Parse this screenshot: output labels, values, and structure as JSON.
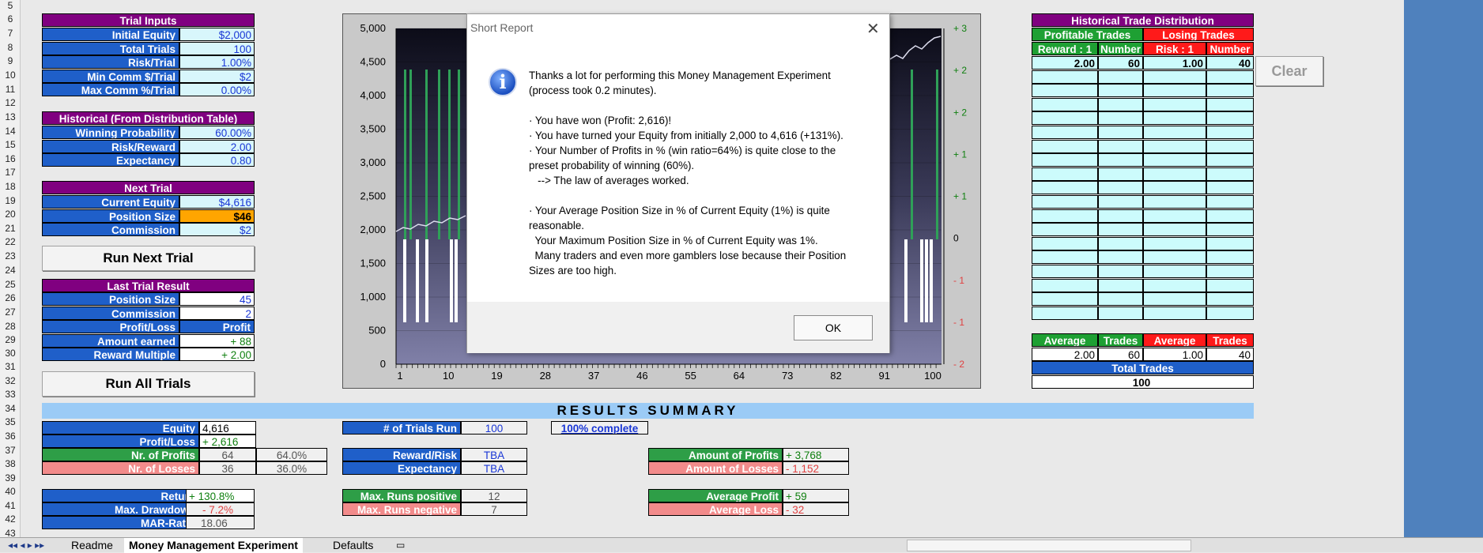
{
  "rows": [
    "5",
    "6",
    "7",
    "8",
    "9",
    "10",
    "11",
    "12",
    "13",
    "14",
    "15",
    "16",
    "17",
    "18",
    "19",
    "20",
    "21",
    "22",
    "23",
    "24",
    "25",
    "26",
    "27",
    "28",
    "29",
    "30",
    "31",
    "32",
    "33",
    "34",
    "35",
    "36",
    "37",
    "38",
    "39",
    "40",
    "41",
    "42",
    "43"
  ],
  "trial_inputs": {
    "header": "Trial  Inputs",
    "items": [
      {
        "label": "Initial Equity",
        "value": "$2,000"
      },
      {
        "label": "Total Trials",
        "value": "100"
      },
      {
        "label": "Risk/Trial",
        "value": "1.00%"
      },
      {
        "label": "Min Comm $/Trial",
        "value": "$2"
      },
      {
        "label": "Max Comm %/Trial",
        "value": "0.00%"
      }
    ]
  },
  "historical": {
    "header": "Historical (From Distribution Table)",
    "items": [
      {
        "label": "Winning Probability",
        "value": "60.00%"
      },
      {
        "label": "Risk/Reward",
        "value": "2.00"
      },
      {
        "label": "Expectancy",
        "value": "0.80"
      }
    ]
  },
  "next_trial": {
    "header": "Next Trial",
    "items": [
      {
        "label": "Current Equity",
        "value": "$4,616"
      },
      {
        "label": "Position Size",
        "value": "$46"
      },
      {
        "label": "Commission",
        "value": "$2"
      }
    ]
  },
  "buttons": {
    "run_next": "Run Next Trial",
    "run_all": "Run All Trials",
    "clear": "Clear"
  },
  "last_trial": {
    "header": "Last Trial Result",
    "items": [
      {
        "label": "Position Size",
        "value": "45"
      },
      {
        "label": "Commission",
        "value": "2"
      },
      {
        "label": "Profit/Loss",
        "value": "Profit"
      },
      {
        "label": "Amount earned",
        "value": "+ 88"
      },
      {
        "label": "Reward Multiple",
        "value": "+ 2.00"
      }
    ]
  },
  "chart": {
    "y_left": [
      "5,000",
      "4,500",
      "4,000",
      "3,500",
      "3,000",
      "2,500",
      "2,000",
      "1,500",
      "1,000",
      "500",
      "0"
    ],
    "y_right": [
      "+ 3",
      "+ 2",
      "+ 2",
      "+ 1",
      "+ 1",
      "0",
      "- 1",
      "- 1",
      "- 2"
    ],
    "x": [
      "1",
      "10",
      "19",
      "28",
      "37",
      "46",
      "55",
      "64",
      "73",
      "82",
      "91",
      "100"
    ]
  },
  "dialog": {
    "title": "Short Report",
    "close": "✕",
    "paragraphs": [
      "Thanks a lot for performing this Money Management Experiment\n(process took 0.2 minutes).",
      "· You have won (Profit: 2,616)!\n· You have turned your Equity from initially 2,000 to 4,616 (+131%).\n· Your Number of Profits in % (win ratio=64%) is quite close to the\npreset probability of winning (60%).\n   --> The law of averages worked.",
      "· Your Average Position Size in % of Current Equity (1%) is quite\nreasonable.\n  Your Maximum Position Size in % of Current Equity was 1%.\n  Many traders and even more gamblers lose because their Position\nSizes are too high."
    ],
    "ok": "OK"
  },
  "distribution": {
    "header": "Historical Trade Distribution",
    "profitable": "Profitable Trades",
    "losing": "Losing Trades",
    "col_reward": "Reward : 1",
    "col_number1": "Number",
    "col_risk": "Risk : 1",
    "col_number2": "Number",
    "first_row": [
      "2.00",
      "60",
      "1.00",
      "40"
    ],
    "avg_hdr": [
      "Average",
      "Trades",
      "Average",
      "Trades"
    ],
    "avg_vals": [
      "2.00",
      "60",
      "1.00",
      "40"
    ],
    "total_label": "Total Trades",
    "total_value": "100"
  },
  "summary": {
    "title": "RESULTS SUMMARY",
    "equity": {
      "label": "Equity",
      "value": "4,616"
    },
    "profit_loss": {
      "label": "Profit/Loss",
      "value": "+ 2,616"
    },
    "nr_profits": {
      "label": "Nr. of Profits",
      "value": "64",
      "pct": "64.0%"
    },
    "nr_losses": {
      "label": "Nr. of Losses",
      "value": "36",
      "pct": "36.0%"
    },
    "return": {
      "label": "Return",
      "value": "+ 130.8%"
    },
    "max_dd": {
      "label": "Max. Drawdown",
      "value": "- 7.2%"
    },
    "mar": {
      "label": "MAR-Ratio",
      "value": "18.06"
    },
    "trials_run": {
      "label": "# of Trials Run",
      "value": "100",
      "pct": "100% complete"
    },
    "reward_risk": {
      "label": "Reward/Risk",
      "value": "TBA"
    },
    "expectancy": {
      "label": "Expectancy",
      "value": "TBA"
    },
    "runs_pos": {
      "label": "Max. Runs positive",
      "value": "12"
    },
    "runs_neg": {
      "label": "Max. Runs negative",
      "value": "7"
    },
    "amt_profits": {
      "label": "Amount of Profits",
      "value": "+ 3,768"
    },
    "amt_losses": {
      "label": "Amount of Losses",
      "value": "- 1,152"
    },
    "avg_profit": {
      "label": "Average Profit",
      "value": "+ 59"
    },
    "avg_loss": {
      "label": "Average Loss",
      "value": "- 32"
    }
  },
  "tabs": [
    "Readme",
    "Money Management Experiment",
    "Defaults"
  ]
}
